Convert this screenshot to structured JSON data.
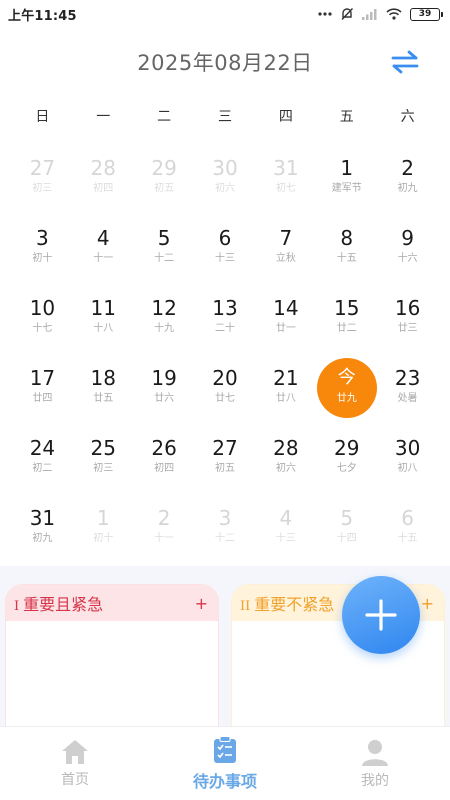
{
  "status_bar": {
    "time": "上午11:45",
    "battery": "39",
    "icons": [
      "more-dots-icon",
      "mute-bell-icon",
      "signal-icon",
      "wifi-icon",
      "battery-icon"
    ]
  },
  "calendar": {
    "title": "2025年08月22日",
    "switch_icon": "swap-arrows-icon",
    "weekdays": [
      "日",
      "一",
      "二",
      "三",
      "四",
      "五",
      "六"
    ],
    "today_label": "今",
    "days": [
      {
        "num": "27",
        "lunar": "初三",
        "other": true
      },
      {
        "num": "28",
        "lunar": "初四",
        "other": true
      },
      {
        "num": "29",
        "lunar": "初五",
        "other": true
      },
      {
        "num": "30",
        "lunar": "初六",
        "other": true
      },
      {
        "num": "31",
        "lunar": "初七",
        "other": true
      },
      {
        "num": "1",
        "lunar": "建军节",
        "other": false
      },
      {
        "num": "2",
        "lunar": "初九",
        "other": false
      },
      {
        "num": "3",
        "lunar": "初十",
        "other": false
      },
      {
        "num": "4",
        "lunar": "十一",
        "other": false
      },
      {
        "num": "5",
        "lunar": "十二",
        "other": false
      },
      {
        "num": "6",
        "lunar": "十三",
        "other": false
      },
      {
        "num": "7",
        "lunar": "立秋",
        "other": false
      },
      {
        "num": "8",
        "lunar": "十五",
        "other": false
      },
      {
        "num": "9",
        "lunar": "十六",
        "other": false
      },
      {
        "num": "10",
        "lunar": "十七",
        "other": false
      },
      {
        "num": "11",
        "lunar": "十八",
        "other": false
      },
      {
        "num": "12",
        "lunar": "十九",
        "other": false
      },
      {
        "num": "13",
        "lunar": "二十",
        "other": false
      },
      {
        "num": "14",
        "lunar": "廿一",
        "other": false
      },
      {
        "num": "15",
        "lunar": "廿二",
        "other": false
      },
      {
        "num": "16",
        "lunar": "廿三",
        "other": false
      },
      {
        "num": "17",
        "lunar": "廿四",
        "other": false
      },
      {
        "num": "18",
        "lunar": "廿五",
        "other": false
      },
      {
        "num": "19",
        "lunar": "廿六",
        "other": false
      },
      {
        "num": "20",
        "lunar": "廿七",
        "other": false
      },
      {
        "num": "21",
        "lunar": "廿八",
        "other": false
      },
      {
        "num": "今",
        "lunar": "廿九",
        "other": false,
        "today": true
      },
      {
        "num": "23",
        "lunar": "处暑",
        "other": false
      },
      {
        "num": "24",
        "lunar": "初二",
        "other": false
      },
      {
        "num": "25",
        "lunar": "初三",
        "other": false
      },
      {
        "num": "26",
        "lunar": "初四",
        "other": false
      },
      {
        "num": "27",
        "lunar": "初五",
        "other": false
      },
      {
        "num": "28",
        "lunar": "初六",
        "other": false
      },
      {
        "num": "29",
        "lunar": "七夕",
        "other": false
      },
      {
        "num": "30",
        "lunar": "初八",
        "other": false
      },
      {
        "num": "31",
        "lunar": "初九",
        "other": false
      },
      {
        "num": "1",
        "lunar": "初十",
        "other": true
      },
      {
        "num": "2",
        "lunar": "十一",
        "other": true
      },
      {
        "num": "3",
        "lunar": "十二",
        "other": true
      },
      {
        "num": "4",
        "lunar": "十三",
        "other": true
      },
      {
        "num": "5",
        "lunar": "十四",
        "other": true
      },
      {
        "num": "6",
        "lunar": "十五",
        "other": true
      }
    ]
  },
  "quadrants": {
    "q1": {
      "roman": "I",
      "title": "重要且紧急",
      "add": "+",
      "color": "#d7344a"
    },
    "q2": {
      "roman": "II",
      "title": "重要不紧急",
      "add": "+",
      "color": "#f0a12a"
    }
  },
  "fab": {
    "icon": "plus-icon"
  },
  "bottom_nav": {
    "items": [
      {
        "label": "首页",
        "icon": "home-icon",
        "active": false
      },
      {
        "label": "待办事项",
        "icon": "todo-list-icon",
        "active": true
      },
      {
        "label": "我的",
        "icon": "user-icon",
        "active": false
      }
    ]
  },
  "colors": {
    "accent_blue": "#3a8ef0",
    "today_orange": "#f8880b",
    "q1_red": "#d7344a",
    "q2_amber": "#f0a12a"
  }
}
